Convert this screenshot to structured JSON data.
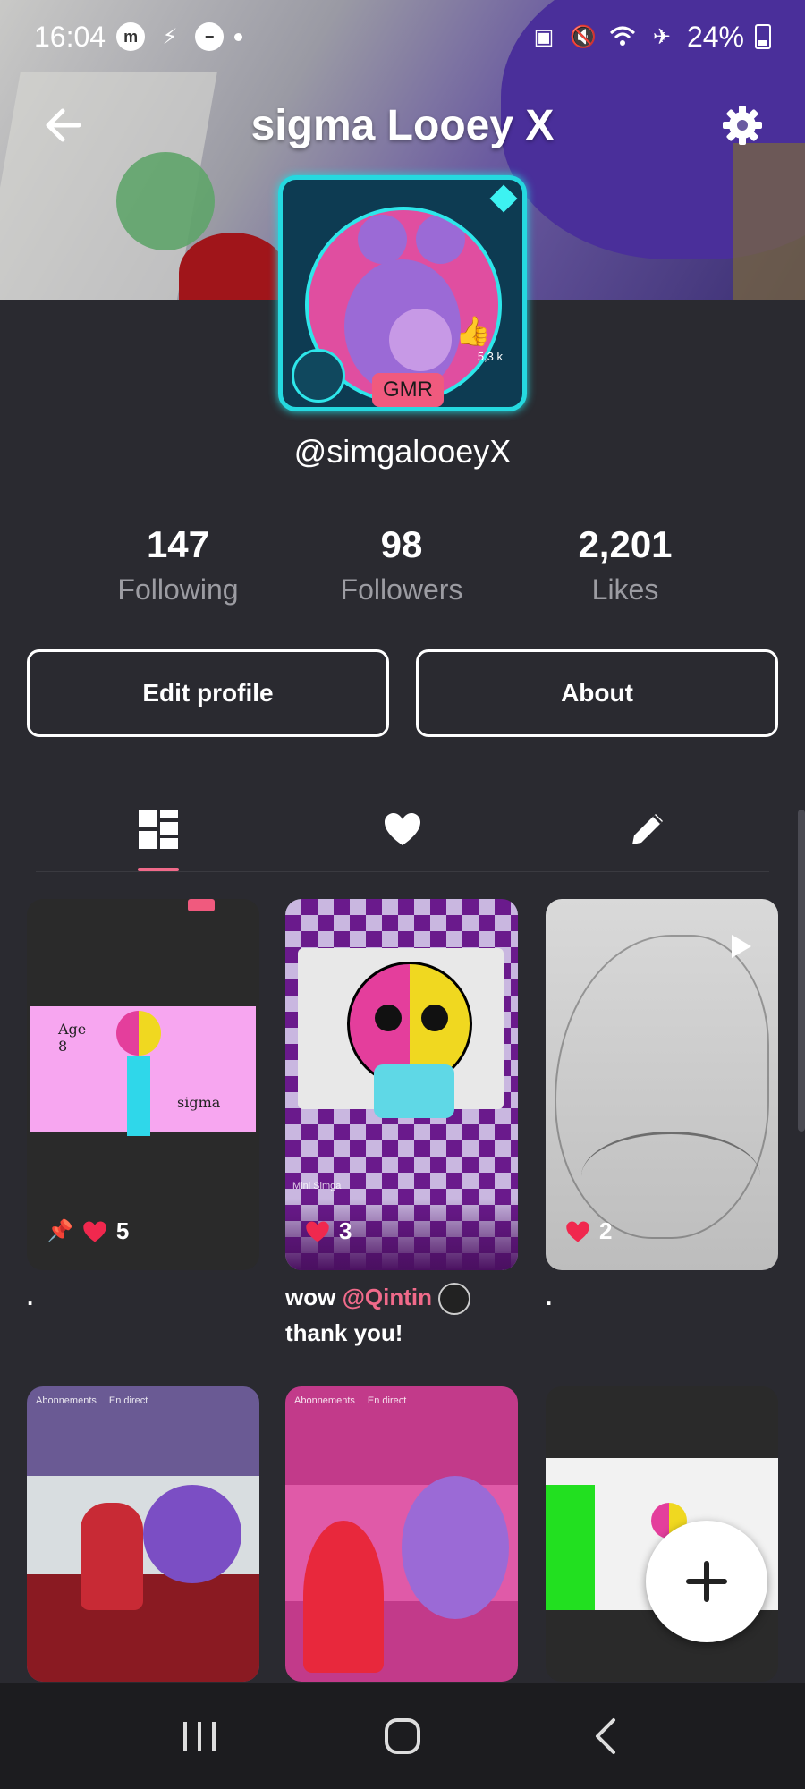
{
  "status_bar": {
    "time": "16:04",
    "battery": "24%"
  },
  "header": {
    "title": "sigma Looey X"
  },
  "avatar": {
    "badge": "GMR",
    "likes_count": "5,3 k"
  },
  "profile": {
    "handle": "@simgalooeyX"
  },
  "stats": [
    {
      "value": "147",
      "label": "Following"
    },
    {
      "value": "98",
      "label": "Followers"
    },
    {
      "value": "2,201",
      "label": "Likes"
    }
  ],
  "buttons": {
    "edit_profile": "Edit profile",
    "about": "About"
  },
  "posts": [
    {
      "likes": "5",
      "caption": ".",
      "text1": "Age\n8",
      "text2": "sigma"
    },
    {
      "likes": "3",
      "caption_pre": "wow ",
      "mention": "@Qintin",
      "caption_post": "thank you!",
      "subtext": "Mini Simga"
    },
    {
      "likes": "2",
      "caption": "."
    }
  ],
  "posts_row2": [
    {
      "tabs": [
        "Abonnements",
        "En direct"
      ]
    },
    {
      "tabs": [
        "Abonnements",
        "En direct"
      ]
    },
    {}
  ],
  "colors": {
    "accent": "#f06a8a",
    "background": "#2a2a30",
    "avatar_frame": "#25d9e0"
  }
}
